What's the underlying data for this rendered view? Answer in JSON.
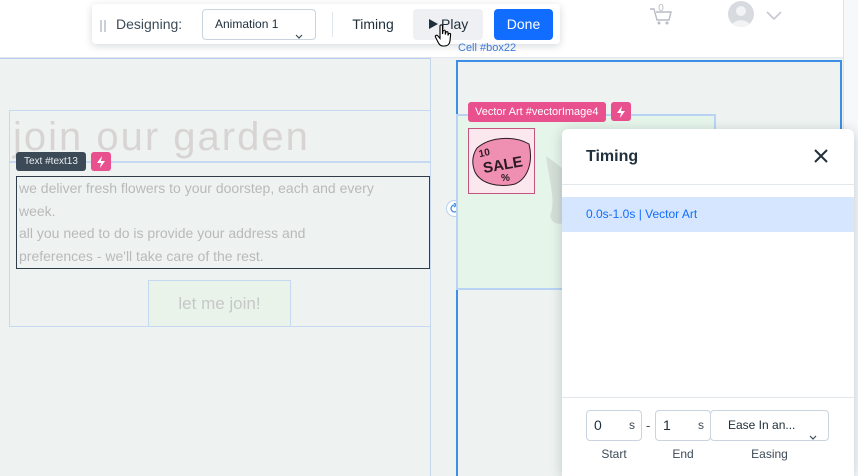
{
  "toolbar": {
    "designing_label": "Designing:",
    "animation_select": "Animation 1",
    "timing_label": "Timing",
    "play_label": "Play",
    "done_label": "Done"
  },
  "header": {
    "cart_count": "0"
  },
  "canvas": {
    "cell_label": "Cell #box22",
    "heading": "join our garden",
    "text_tag": "Text #text13",
    "paragraph_line1": "we deliver fresh flowers to your doorstep, each and every",
    "paragraph_line2": "week.",
    "paragraph_line3": "all you need to do is provide your address and",
    "paragraph_line4": "preferences - we'll take care of the rest.",
    "join_button": "let me join!",
    "vector_tag": "Vector Art #vectorImage4",
    "sale_number": "10",
    "sale_word": "SALE",
    "sale_percent": "%"
  },
  "timing_panel": {
    "title": "Timing",
    "timeline_item": "0.0s-1.0s | Vector Art",
    "start_value": "0",
    "start_unit": "s",
    "dash": "-",
    "end_value": "1",
    "end_unit": "s",
    "easing_value": "Ease In an...",
    "start_label": "Start",
    "end_label": "End",
    "easing_label": "Easing"
  },
  "colors": {
    "accent_blue": "#116dff",
    "badge_pink": "#e8508e",
    "selection_blue": "#3c8ee6"
  },
  "icons": [
    "drag-grip-icon",
    "chevron-down-icon",
    "play-icon",
    "hand-cursor-icon",
    "cart-icon",
    "avatar-icon",
    "bolt-icon",
    "rotate-icon",
    "close-icon"
  ]
}
